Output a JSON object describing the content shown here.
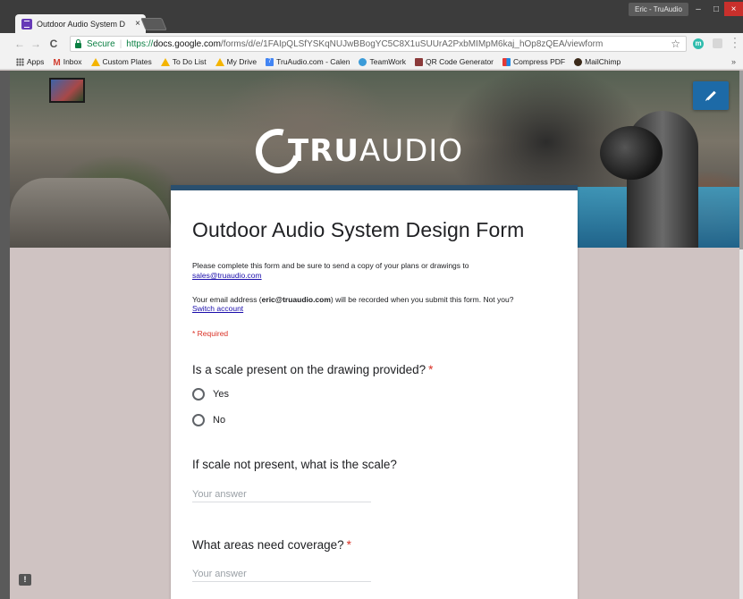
{
  "browser": {
    "tab_title": "Outdoor Audio System D",
    "tab_close": "×",
    "profile_name": "Eric - TruAudio",
    "window_min": "–",
    "window_max": "□",
    "window_close": "×",
    "nav_back": "←",
    "nav_forward": "→",
    "nav_reload": "C",
    "secure_label": "Secure",
    "url_scheme": "https://",
    "url_host": "docs.google.com",
    "url_path": "/forms/d/e/1FAIpQLSfYSKqNUJwBBogYC5C8X1uSUUrA2PxbMIMpM6kaj_hOp8zQEA/viewform",
    "star": "☆",
    "ext_label": "m",
    "bookmarks_more": "»",
    "bookmarks": [
      {
        "label": "Apps"
      },
      {
        "label": "Inbox"
      },
      {
        "label": "Custom Plates"
      },
      {
        "label": "To Do List"
      },
      {
        "label": "My Drive"
      },
      {
        "label": "TruAudio.com - Calen",
        "icon_text": "7"
      },
      {
        "label": "TeamWork"
      },
      {
        "label": "QR Code Generator"
      },
      {
        "label": "Compress PDF"
      },
      {
        "label": "MailChimp"
      }
    ]
  },
  "banner": {
    "logo_tru": "TRU",
    "logo_audio": "AUDIO"
  },
  "form": {
    "title": "Outdoor Audio System Design Form",
    "description": "Please complete this form and be sure to send a copy of your plans or drawings to",
    "description_link": "sales@truaudio.com",
    "email_note_prefix": "Your email address (",
    "email_address": "eric@truaudio.com",
    "email_note_suffix": ") will be recorded when you submit this form. Not you?",
    "switch_account": "Switch account",
    "required_note": "* Required",
    "questions": [
      {
        "title": "Is a scale present on the drawing provided?",
        "required_mark": "*",
        "options": [
          "Yes",
          "No"
        ]
      },
      {
        "title": "If scale not present, what is the scale?",
        "placeholder": "Your answer"
      },
      {
        "title": "What areas need coverage?",
        "required_mark": "*",
        "placeholder": "Your answer"
      }
    ]
  },
  "feedback_icon": "!",
  "colors": {
    "header_accent": "#2a4f6e",
    "required": "#d93025",
    "edit_button": "#1d6aa7",
    "page_background": "#cfc3c2"
  }
}
